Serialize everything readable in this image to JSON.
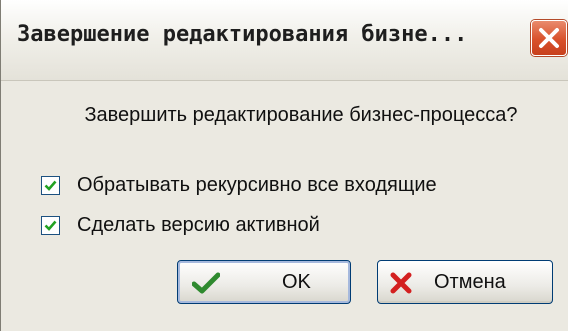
{
  "window": {
    "title": "Завершение редактирования бизне...",
    "close_icon": "close-icon",
    "close_color": "#d9512b"
  },
  "message": {
    "question": "Завершить редактирование бизнес-процесса?"
  },
  "options": [
    {
      "label": "Обратывать рекурсивно все входящие",
      "checked": true
    },
    {
      "label": "Сделать версию активной",
      "checked": true
    }
  ],
  "buttons": {
    "ok_label": "OK",
    "ok_icon": "checkmark-icon",
    "ok_icon_color": "#2f8a2f",
    "cancel_label": "Отмена",
    "cancel_icon": "cross-icon",
    "cancel_icon_color": "#d32020"
  }
}
